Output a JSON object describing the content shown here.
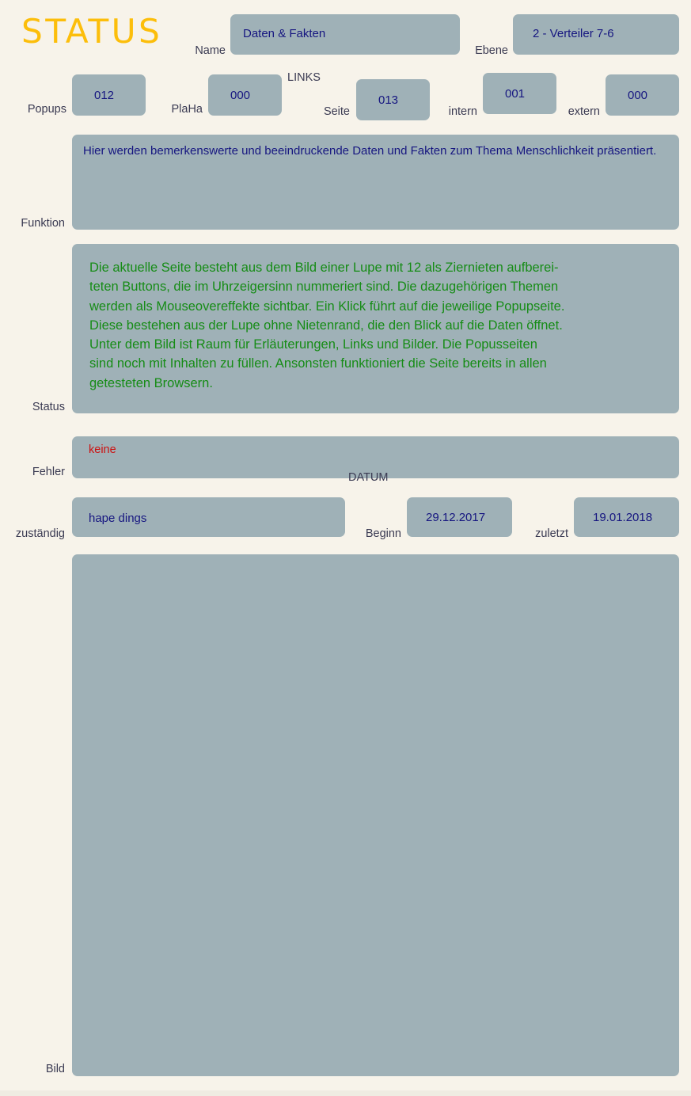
{
  "page": {
    "title": "STATUS",
    "background_color": "#f7f3ea",
    "box_color": "#9fb1b7",
    "title_color": "#fcbe0b",
    "value_color": "#161680",
    "label_color": "#3a3a52",
    "status_color": "#168c16",
    "error_color": "#cc1111"
  },
  "fields": {
    "name": {
      "label": "Name",
      "value": "Daten & Fakten"
    },
    "ebene": {
      "label": "Ebene",
      "value": "2 - Verteiler 7-6"
    },
    "popups": {
      "label": "Popups",
      "value": "012"
    },
    "plaha": {
      "label": "PlaHa",
      "value": "000"
    },
    "links_group": {
      "label": "LINKS"
    },
    "seite": {
      "label": "Seite",
      "value": "013"
    },
    "intern": {
      "label": "intern",
      "value": "001"
    },
    "extern": {
      "label": "extern",
      "value": "000"
    },
    "funktion": {
      "label": "Funktion",
      "value": "Hier werden bemerkenswerte und beeindruckende Daten und Fakten zum Thema Menschlichkeit präsentiert."
    },
    "status": {
      "label": "Status",
      "value": "Die aktuelle Seite besteht aus dem Bild einer Lupe mit 12 als Ziernieten aufberei-\nteten Buttons, die im Uhrzeigersinn nummeriert sind. Die dazugehörigen Themen\nwerden als Mouseovereffekte sichtbar. Ein Klick führt auf die jeweilige Popupseite.\nDiese bestehen aus der Lupe ohne Nietenrand, die den Blick auf die Daten öffnet.\nUnter dem Bild ist Raum für Erläuterungen, Links und Bilder. Die Popusseiten\nsind noch mit Inhalten zu füllen. Ansonsten funktioniert die Seite bereits in allen\ngetesteten Browsern."
    },
    "fehler": {
      "label": "Fehler",
      "value": "keine"
    },
    "zustaendig": {
      "label": "zuständig",
      "value": "hape dings"
    },
    "datum_group": {
      "label": "DATUM"
    },
    "beginn": {
      "label": "Beginn",
      "value": "29.12.2017"
    },
    "zuletzt": {
      "label": "zuletzt",
      "value": "19.01.2018"
    },
    "bild": {
      "label": "Bild",
      "value": ""
    }
  }
}
